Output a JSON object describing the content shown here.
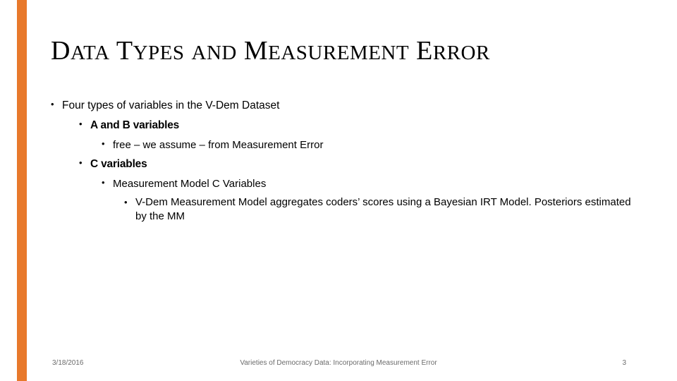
{
  "slide": {
    "title_parts": [
      {
        "cap": "D",
        "rest": "ATA"
      },
      {
        "cap": "T",
        "rest": "YPES"
      },
      {
        "cap": "",
        "rest": "AND"
      },
      {
        "cap": "M",
        "rest": "EASUREMENT"
      },
      {
        "cap": "E",
        "rest": "RROR"
      }
    ],
    "title_plain": "Data Types and Measurement Error",
    "bullets": {
      "l1": "Four types of variables in the V-Dem Dataset",
      "l2a": "A and B variables",
      "l3a": "free – we assume – from Measurement Error",
      "l2b": "C variables",
      "l3b": "Measurement Model C Variables",
      "l4b": "V-Dem Measurement Model aggregates coders’ scores using a Bayesian IRT Model. Posteriors estimated by the MM"
    },
    "bullet_glyph": "•",
    "footer": {
      "date": "3/18/2016",
      "center": "Varieties of Democracy Data: Incorporating Measurement Error",
      "page": "3"
    },
    "colors": {
      "accent": "#E8792B",
      "text": "#000000",
      "footer_text": "#6b6b6b",
      "background": "#ffffff"
    }
  }
}
